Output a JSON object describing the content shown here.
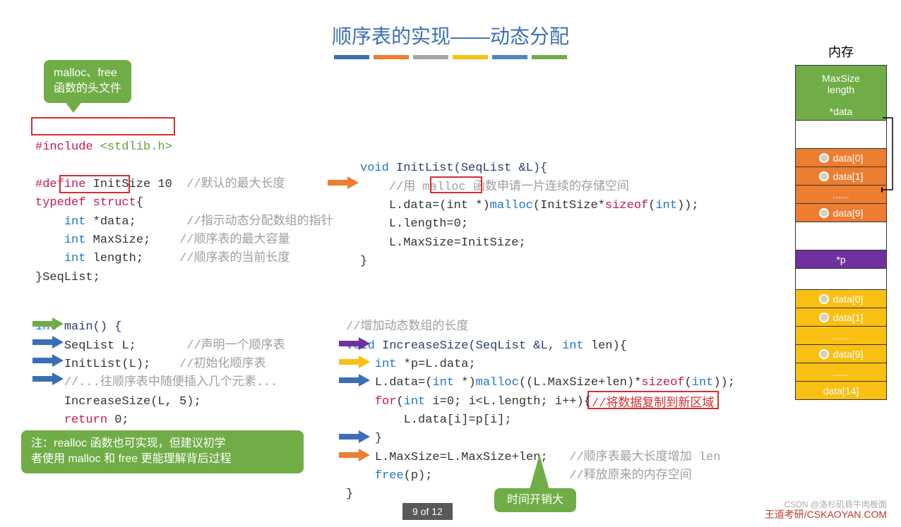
{
  "title": "顺序表的实现——动态分配",
  "callouts": {
    "malloc_header": "malloc、free\n函数的头文件",
    "realloc_note": "注：realloc 函数也可实现，但建议初学\n者使用 malloc 和 free 更能理解背后过程",
    "time_cost": "时间开销大",
    "copy_note": "//将数据复制到新区域"
  },
  "code_left_top": {
    "include": "#include",
    "stdlib": "<stdlib.h>",
    "define": "#define",
    "define_rest": "InitSize 10",
    "define_comment": "//默认的最大长度",
    "typedef": "typedef",
    "struct": "struct",
    "lb": "{",
    "int": "int",
    "star_data": "*data;",
    "data_comment": "//指示动态分配数组的指针",
    "maxsize": "MaxSize;",
    "maxsize_comment": "//顺序表的最大容量",
    "length": "length;",
    "length_comment": "//顺序表的当前长度",
    "seqlist": "}SeqList;"
  },
  "code_left_bottom": {
    "int": "int",
    "main": "main() {",
    "seqlist_l": "SeqList L;",
    "seqlist_comment": "//声明一个顺序表",
    "initlist": "InitList(L);",
    "initlist_comment": "//初始化顺序表",
    "insert_comment": "//...往顺序表中随便插入几个元素...",
    "increase": "IncreaseSize(L, 5);",
    "return": "return",
    "zero": "0;",
    "rb": "}"
  },
  "code_right_top": {
    "void": "void",
    "initlist": "InitList(SeqList &L){",
    "malloc_comment": "//用 malloc 函数申请一片连续的存储空间",
    "ldata": "L.data=",
    "cast": "(int *)",
    "malloc": "malloc",
    "malloc_args": "(InitSize*",
    "sizeof": "sizeof",
    "sizeof_args": "(",
    "int_t": "int",
    "close": "));",
    "llength": "L.length=0;",
    "lmaxsize": "L.MaxSize=InitSize;",
    "rb": "}"
  },
  "code_right_bottom": {
    "comment1": "//增加动态数组的长度",
    "void": "void",
    "increase": "IncreaseSize(SeqList &L,",
    "int": "int",
    "len": "len){",
    "intp": "int",
    "peq": "*p=L.data;",
    "ldata": "L.data=(",
    "intcast": "int",
    "cast2": " *)",
    "malloc": "malloc",
    "margs": "((L.MaxSize+len)*",
    "sizeof": "sizeof",
    "sargs": "(",
    "intt": "int",
    "close": "));",
    "for": "for",
    "forargs": "(",
    "inti": "int",
    "irest": " i=0; i<L.length; i++){",
    "copy": "L.data[i]=p[i];",
    "rb1": "}",
    "lmax": "L.MaxSize=L.MaxSize+len;",
    "lmax_comment": "//顺序表最大长度增加 len",
    "free": "free",
    "freeargs": "(p);",
    "free_comment": "//释放原来的内存空间",
    "rb2": "}"
  },
  "memory": {
    "title": "内存",
    "maxsize": "MaxSize",
    "length": "length",
    "data": "*data",
    "data0": "data[0]",
    "data1": "data[1]",
    "dots": "......",
    "data9": "data[9]",
    "p": "*p",
    "data14": "data[14]"
  },
  "page": "9 of 12",
  "footer": "王道考研/CSKAOYAN.COM",
  "footer_gray": "CSDN @洛杉矶县牛肉板面"
}
